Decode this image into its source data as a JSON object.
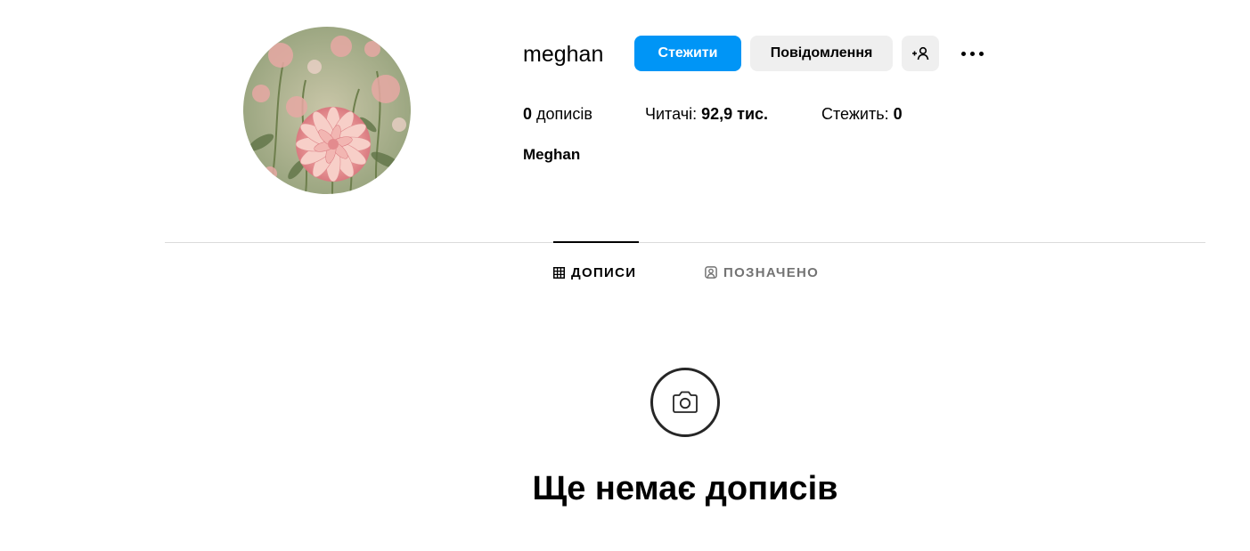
{
  "profile": {
    "username": "meghan",
    "full_name": "Meghan",
    "avatar_icon": "dahlia-flower-photo"
  },
  "actions": {
    "follow_label": "Стежити",
    "message_label": "Повідомлення",
    "suggest_icon": "add-person-icon",
    "more_icon": "more-dots-icon"
  },
  "stats": {
    "posts_count": "0",
    "posts_label": "дописів",
    "followers_label": "Читачі:",
    "followers_count": "92,9 тис.",
    "following_label": "Стежить:",
    "following_count": "0"
  },
  "tabs": [
    {
      "label": "ДОПИСИ",
      "icon": "grid-icon",
      "active": true
    },
    {
      "label": "ПОЗНАЧЕНО",
      "icon": "tagged-user-icon",
      "active": false
    }
  ],
  "empty_state": {
    "icon": "camera-icon",
    "title": "Ще немає дописів"
  },
  "colors": {
    "accent": "#0095f6",
    "secondary_button": "#efefef",
    "divider": "#dbdbdb",
    "muted_text": "#737373"
  }
}
